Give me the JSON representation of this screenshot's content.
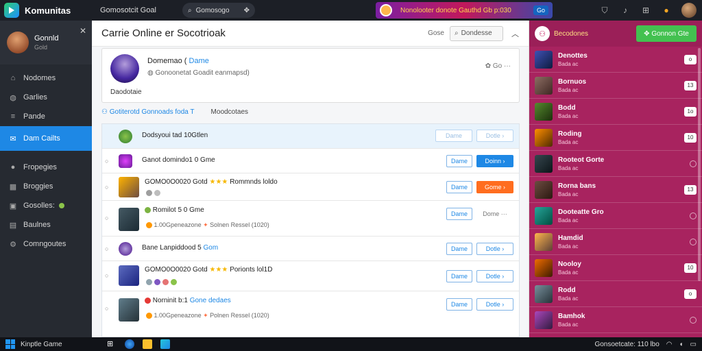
{
  "app": {
    "name": "Komunitas",
    "subtitle": "Gomosotcit Goal"
  },
  "topbar": {
    "search_text": "Gomosogo",
    "promo_text": "Nonolooter donote Gauthd Gb p:030",
    "promo_chip": "Go"
  },
  "sidebar": {
    "profile": {
      "name": "Gonnld",
      "sub": "Gold"
    },
    "items_top": [
      {
        "label": "Nodomes",
        "icon": "home-icon"
      },
      {
        "label": "Garlies",
        "icon": "globe-icon"
      },
      {
        "label": "Pande",
        "icon": "list-icon"
      },
      {
        "label": "Dam Cailts",
        "icon": "chat-icon",
        "active": true
      }
    ],
    "items_bottom": [
      {
        "label": "Fropegies",
        "icon": "circle-icon"
      },
      {
        "label": "Broggies",
        "icon": "grid-icon"
      },
      {
        "label": "Gosolles:",
        "icon": "box-icon"
      },
      {
        "label": "Baulnes",
        "icon": "folder-icon"
      },
      {
        "label": "Comngoutes",
        "icon": "gear-icon"
      }
    ]
  },
  "main": {
    "title": "Carrie Online er Socotrioak",
    "meta": "Gose",
    "search_text": "Dondesse",
    "card": {
      "name": "Domemao (",
      "name_tag": "Dame",
      "sub": "Gonoonetat Goadit eanmapsd)",
      "desc": "Daodotaie",
      "right": "Go"
    },
    "filters": [
      "Gotiterotd Gonnoads foda T",
      "Moodcotaes"
    ],
    "highlight_row": {
      "text": "Dodsyoui tad 10Gtlen",
      "btn1": "Dame",
      "btn2": "Dotle"
    },
    "rows": [
      {
        "title": "Ganot domindo1 0 Gme",
        "btn1": "Dame",
        "btn2": "Doinn"
      },
      {
        "title": "GOMO0O0020 Gotd",
        "rating": "Rommnds loldo",
        "btn1": "Dame",
        "btn2": "Gome"
      },
      {
        "title": "Romilot 5 0 Gme",
        "meta": "1.00Gpeneazone",
        "meta2": "Solnen Ressel (1020)",
        "btn1": "Dame",
        "btn2": "Dome"
      },
      {
        "title": "Bane Lanpiddood 5",
        "title_tag": "Gom",
        "btn1": "Dame",
        "btn2": "Dotle"
      },
      {
        "title": "GOMO0O0020 Gotd",
        "rating": "Porionts lol1D",
        "btn1": "Dame",
        "btn2": "Dotle"
      },
      {
        "title": "Norninit b:1",
        "title_tag": "Gone dedaes",
        "meta": "1.00Gpeneazone",
        "meta2": "Polnen Ressel (1020)",
        "btn1": "Dame",
        "btn2": "Dotle"
      }
    ]
  },
  "right_panel": {
    "title": "Becodones",
    "button": "Gonnon Gte",
    "items": [
      {
        "name": "Denottes",
        "sub": "Bada ac",
        "badge": "o"
      },
      {
        "name": "Bornuos",
        "sub": "Bada ac",
        "badge": "13"
      },
      {
        "name": "Bodd",
        "sub": "Bada ac",
        "badge": "1o"
      },
      {
        "name": "Roding",
        "sub": "Bada ac",
        "badge": "10"
      },
      {
        "name": "Rooteot Gorte",
        "sub": "Bada ac",
        "badge": ""
      },
      {
        "name": "Rorna bans",
        "sub": "Bada ac",
        "badge": "13"
      },
      {
        "name": "Dooteatte Gro",
        "sub": "Bada ac",
        "badge": ""
      },
      {
        "name": "Hamdid",
        "sub": "Bada ac",
        "badge": ""
      },
      {
        "name": "Nooloy",
        "sub": "Bada ac",
        "badge": "10"
      },
      {
        "name": "Rodd",
        "sub": "Bada ac",
        "badge": "o"
      },
      {
        "name": "Bamhok",
        "sub": "Bada ac",
        "badge": ""
      }
    ]
  },
  "taskbar": {
    "label": "Kinptle Game",
    "tray_text": "Gonsoetcate: 110 lbo"
  }
}
